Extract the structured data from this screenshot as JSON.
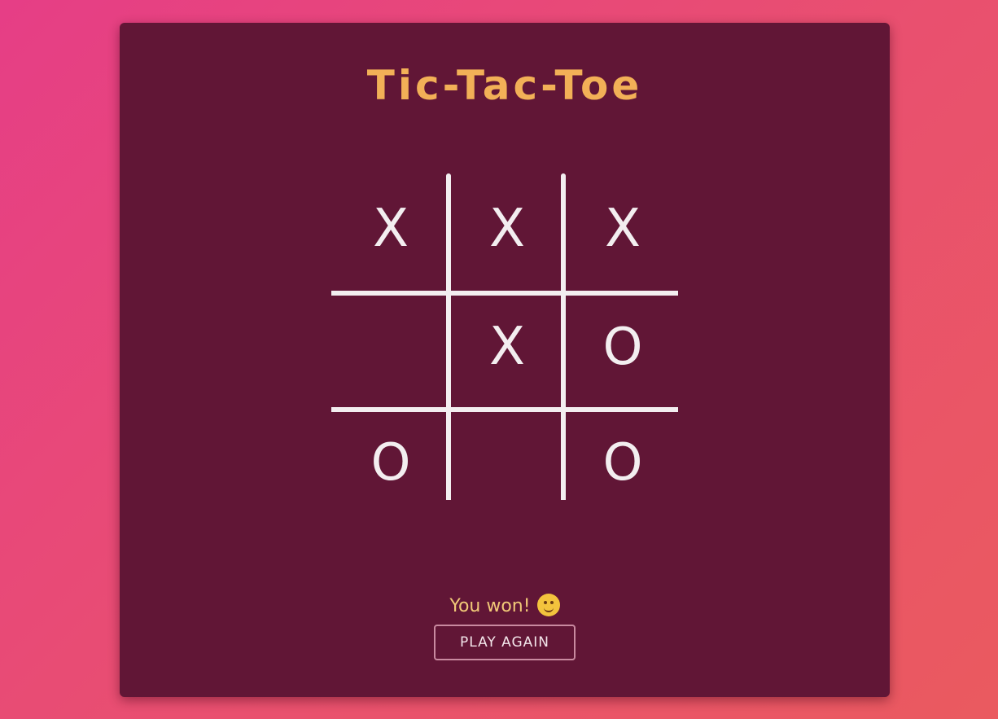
{
  "game": {
    "title": "Tic-Tac-Toe",
    "board": [
      [
        "X",
        "X",
        "X"
      ],
      [
        "",
        "X",
        "O"
      ],
      [
        "O",
        "",
        "O"
      ]
    ],
    "status_text": "You won!",
    "status_icon": "grinning-face-emoji-icon",
    "play_again_label": "PLAY AGAIN"
  },
  "colors": {
    "background_gradient": [
      "#e63e86",
      "#ea5a5f"
    ],
    "card": "#611636",
    "title": "#f2b057",
    "marks": "#f3eef0",
    "status": "#f1c978"
  }
}
